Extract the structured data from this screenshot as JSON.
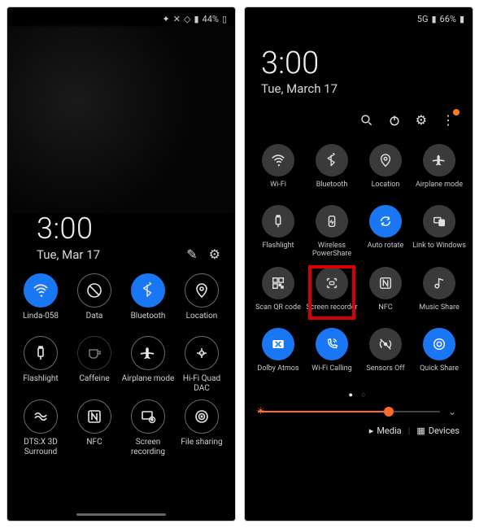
{
  "left": {
    "status": {
      "battery": "44%"
    },
    "time": "3:00",
    "date": "Tue, Mar 17",
    "tiles": [
      {
        "label": "Linda-058",
        "icon": "wifi-icon",
        "state": "on"
      },
      {
        "label": "Data",
        "icon": "data-icon",
        "state": "off"
      },
      {
        "label": "Bluetooth",
        "icon": "bluetooth-icon",
        "state": "on"
      },
      {
        "label": "Location",
        "icon": "location-icon",
        "state": "off"
      },
      {
        "label": "Flashlight",
        "icon": "flashlight-icon",
        "state": "off"
      },
      {
        "label": "Caffeine",
        "icon": "caffeine-icon",
        "state": "dim"
      },
      {
        "label": "Airplane mode",
        "icon": "airplane-icon",
        "state": "off"
      },
      {
        "label": "Hi-Fi Quad DAC",
        "icon": "hifi-icon",
        "state": "off"
      },
      {
        "label": "DTS:X 3D Surround",
        "icon": "dts-icon",
        "state": "off"
      },
      {
        "label": "NFC",
        "icon": "nfc-icon",
        "state": "off"
      },
      {
        "label": "Screen recording",
        "icon": "screen-recording-icon",
        "state": "off"
      },
      {
        "label": "File sharing",
        "icon": "file-sharing-icon",
        "state": "off"
      }
    ]
  },
  "right": {
    "status": {
      "network": "5G",
      "battery": "66%"
    },
    "time": "3:00",
    "date": "Tue, March 17",
    "tiles": [
      {
        "label": "Wi-Fi",
        "icon": "wifi-icon",
        "state": "off"
      },
      {
        "label": "Bluetooth",
        "icon": "bluetooth-icon",
        "state": "off"
      },
      {
        "label": "Location",
        "icon": "location-icon",
        "state": "off"
      },
      {
        "label": "Airplane mode",
        "icon": "airplane-icon",
        "state": "off"
      },
      {
        "label": "Flashlight",
        "icon": "flashlight-icon",
        "state": "off"
      },
      {
        "label": "Wireless PowerShare",
        "icon": "powershare-icon",
        "state": "off"
      },
      {
        "label": "Auto rotate",
        "icon": "autorotate-icon",
        "state": "on"
      },
      {
        "label": "Link to Windows",
        "icon": "link-windows-icon",
        "state": "off"
      },
      {
        "label": "Scan QR code",
        "icon": "qr-icon",
        "state": "off"
      },
      {
        "label": "Screen recorder",
        "icon": "screen-recorder-icon",
        "state": "off",
        "highlight": true
      },
      {
        "label": "NFC",
        "icon": "nfc-icon",
        "state": "off"
      },
      {
        "label": "Music Share",
        "icon": "music-share-icon",
        "state": "off"
      },
      {
        "label": "Dolby Atmos",
        "icon": "dolby-icon",
        "state": "on"
      },
      {
        "label": "Wi-Fi Calling",
        "icon": "wifi-calling-icon",
        "state": "on"
      },
      {
        "label": "Sensors Off",
        "icon": "sensors-off-icon",
        "state": "off"
      },
      {
        "label": "Quick Share",
        "icon": "quick-share-icon",
        "state": "on"
      }
    ],
    "brightness_percent": 72,
    "bottom": {
      "media": "Media",
      "devices": "Devices"
    }
  }
}
